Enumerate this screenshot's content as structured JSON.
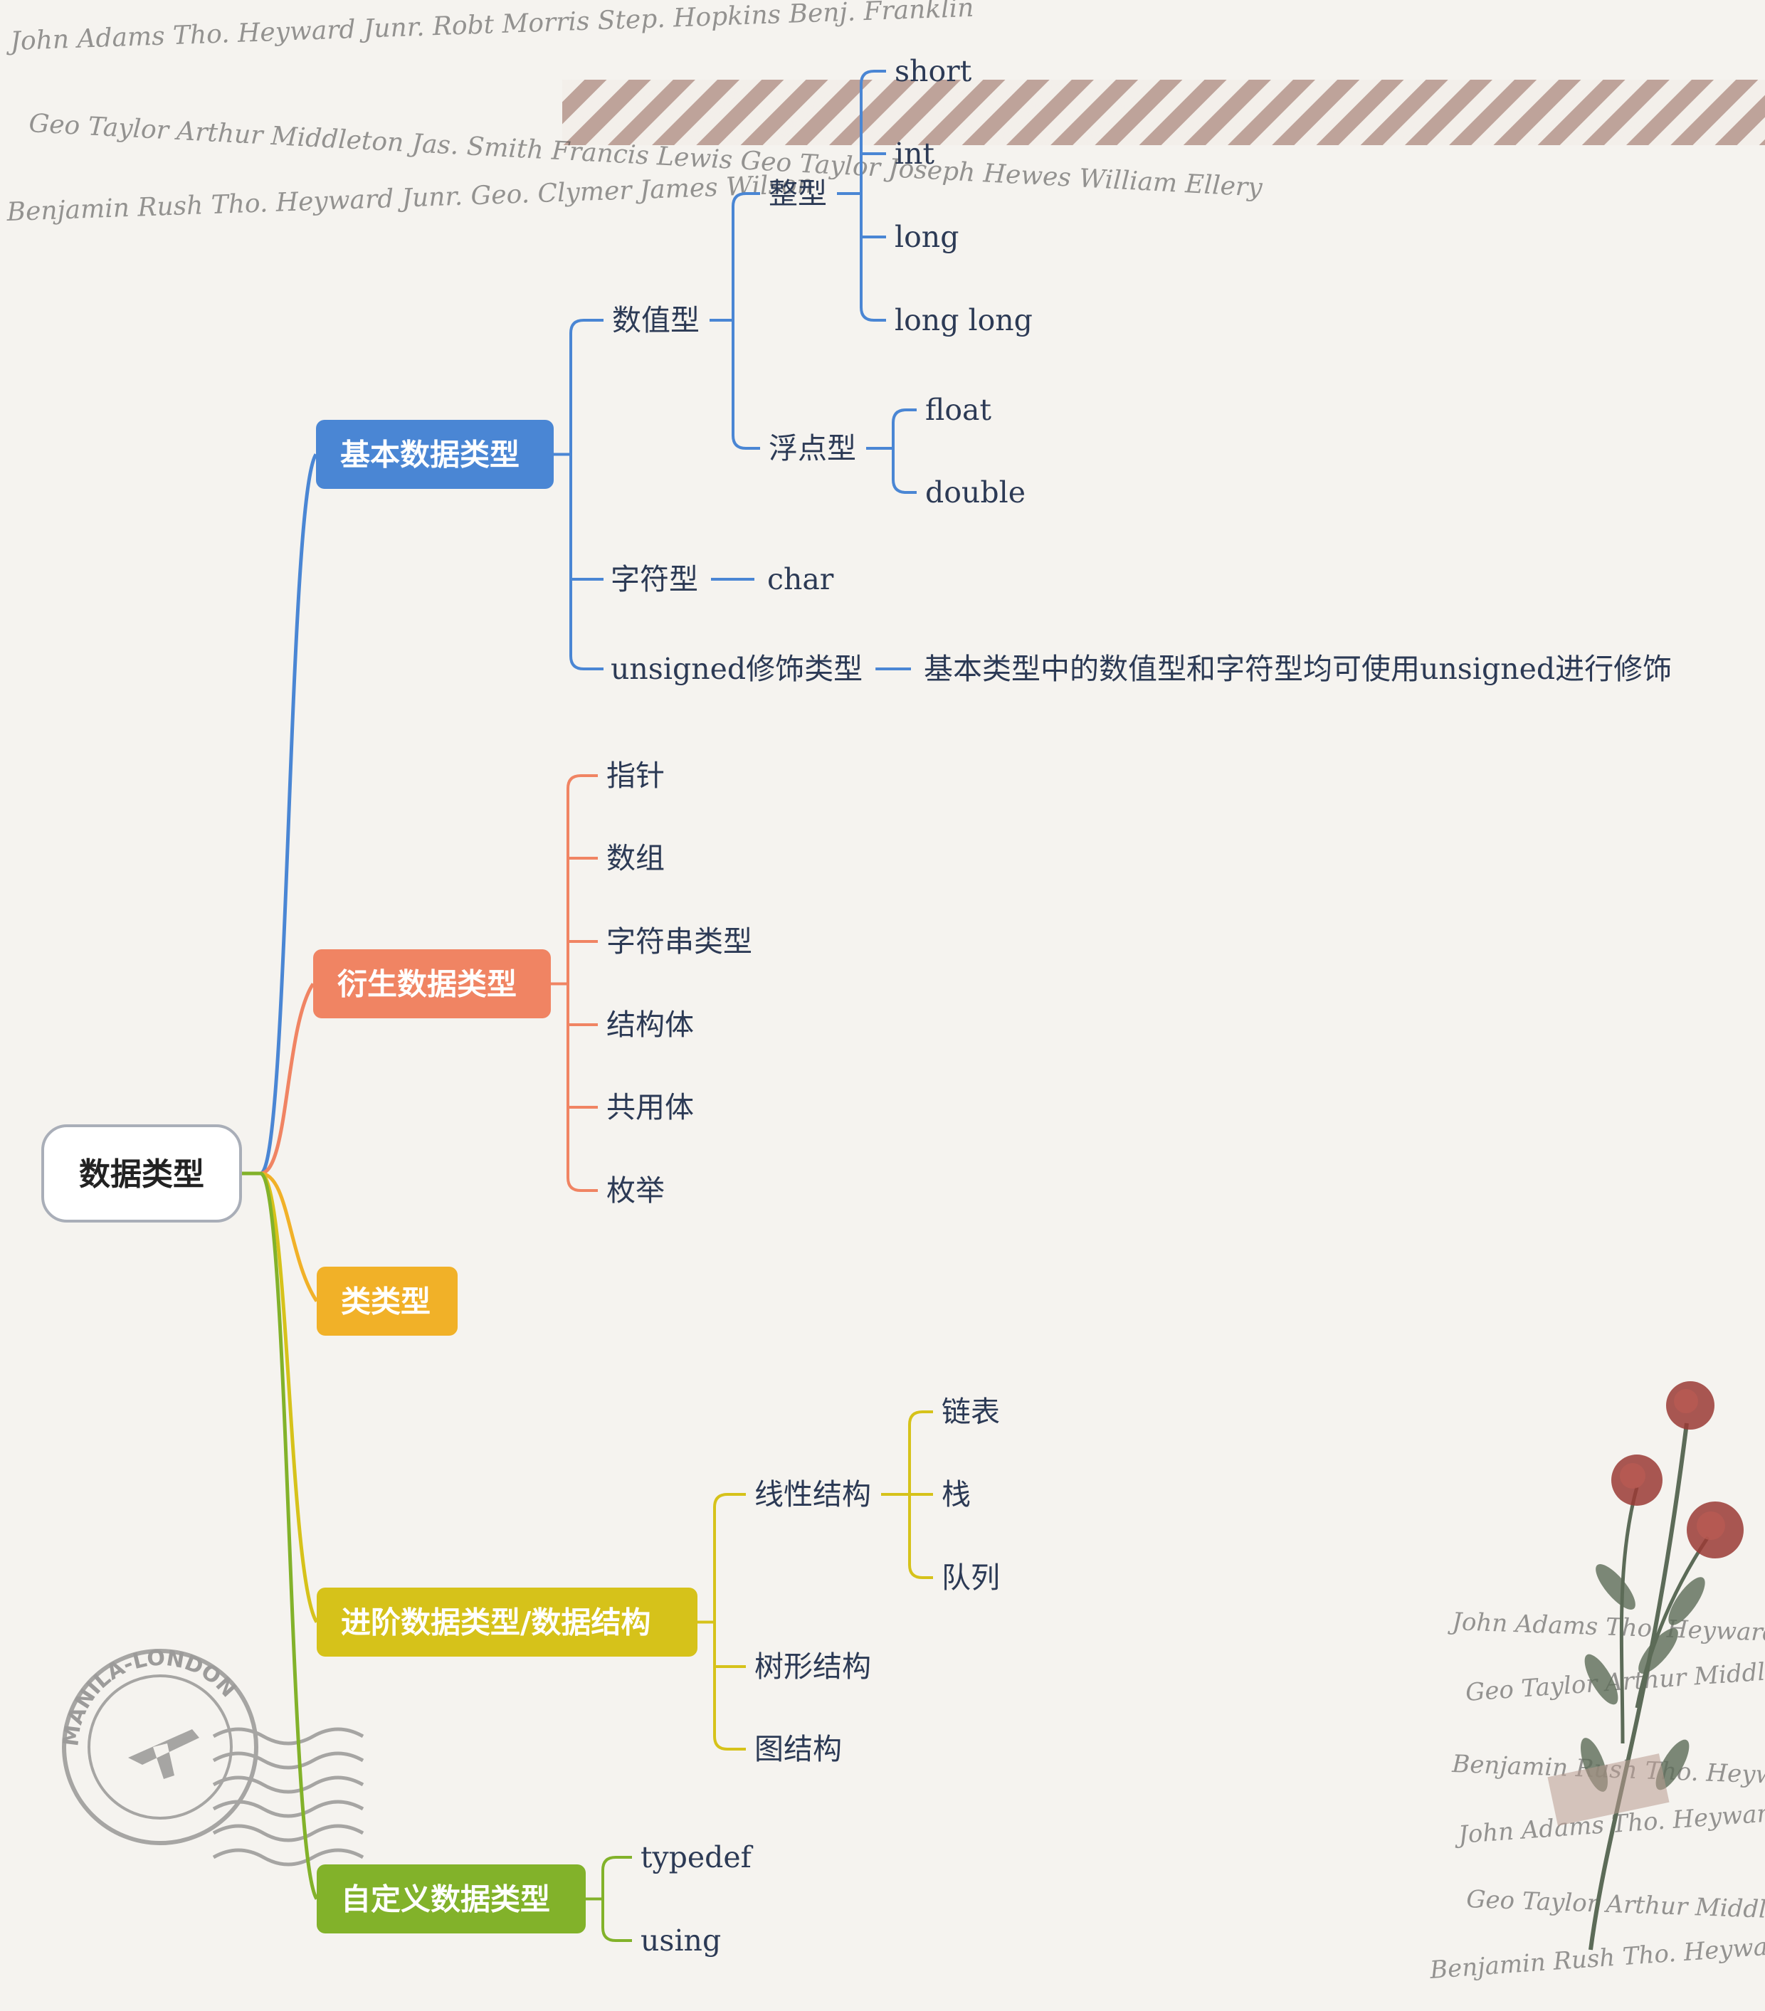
{
  "root": {
    "label": "数据类型"
  },
  "branches": [
    {
      "label": "基本数据类型",
      "color": "#4a86d4",
      "children": [
        {
          "label": "数值型",
          "children": [
            {
              "label": "整型",
              "children": [
                {
                  "label": "short"
                },
                {
                  "label": "int"
                },
                {
                  "label": "long"
                },
                {
                  "label": "long long"
                }
              ]
            },
            {
              "label": "浮点型",
              "children": [
                {
                  "label": "float"
                },
                {
                  "label": "double"
                }
              ]
            }
          ]
        },
        {
          "label": "字符型",
          "children": [
            {
              "label": "char"
            }
          ]
        },
        {
          "label": "unsigned修饰类型",
          "children": [
            {
              "label": "基本类型中的数值型和字符型均可使用unsigned进行修饰"
            }
          ]
        }
      ]
    },
    {
      "label": "衍生数据类型",
      "color": "#f08463",
      "children": [
        {
          "label": "指针"
        },
        {
          "label": "数组"
        },
        {
          "label": "字符串类型"
        },
        {
          "label": "结构体"
        },
        {
          "label": "共用体"
        },
        {
          "label": "枚举"
        }
      ]
    },
    {
      "label": "类类型",
      "color": "#f1b128"
    },
    {
      "label": "进阶数据类型/数据结构",
      "color": "#d6c21a",
      "children": [
        {
          "label": "线性结构",
          "children": [
            {
              "label": "链表"
            },
            {
              "label": "栈"
            },
            {
              "label": "队列"
            }
          ]
        },
        {
          "label": "树形结构"
        },
        {
          "label": "图结构"
        }
      ]
    },
    {
      "label": "自定义数据类型",
      "color": "#82b22a",
      "children": [
        {
          "label": "typedef"
        },
        {
          "label": "using"
        }
      ]
    }
  ],
  "decor": {
    "signatures": [
      "John Adams  Tho. Heyward Junr.  Robt Morris  Step. Hopkins  Benj. Franklin",
      "Geo Taylor  Arthur Middleton  Jas. Smith  Francis Lewis  Geo Taylor  Joseph Hewes  William Ellery",
      "Benjamin Rush  Tho. Heyward Junr.  Geo. Clymer  James Wilson"
    ],
    "stamp_text": "MANILA-LONDON",
    "colors": {
      "tape": "#b89a90",
      "rose": "#9a3a35",
      "leaf": "#5c6b58"
    }
  }
}
